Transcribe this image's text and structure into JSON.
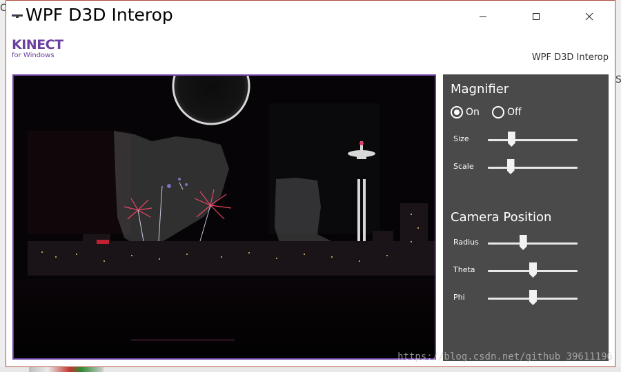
{
  "window": {
    "title": "WPF D3D Interop",
    "minimize_glyph": "—",
    "maximize_glyph": "☐",
    "close_glyph": "✕"
  },
  "header": {
    "logo_brand": "KINECT",
    "logo_sub": "for Windows",
    "app_subtitle": "WPF D3D Interop"
  },
  "background": {
    "left_letter": "C",
    "right_letter": "S"
  },
  "magnifier": {
    "title": "Magnifier",
    "on_label": "On",
    "off_label": "Off",
    "selected": "On",
    "size_label": "Size",
    "scale_label": "Scale",
    "size_value": 0.26,
    "scale_value": 0.25
  },
  "camera": {
    "title": "Camera Position",
    "radius_label": "Radius",
    "theta_label": "Theta",
    "phi_label": "Phi",
    "radius_value": 0.39,
    "theta_value": 0.5,
    "phi_value": 0.5
  },
  "watermark": "https://blog.csdn.net/github_39611196",
  "colors": {
    "accent": "#6b3fa0",
    "panel": "#4a4a4a",
    "window_border": "#b04a3a"
  },
  "icons": {
    "app": "kinect-sensor-icon",
    "minimize": "minimize-icon",
    "maximize": "maximize-icon",
    "close": "close-icon"
  }
}
